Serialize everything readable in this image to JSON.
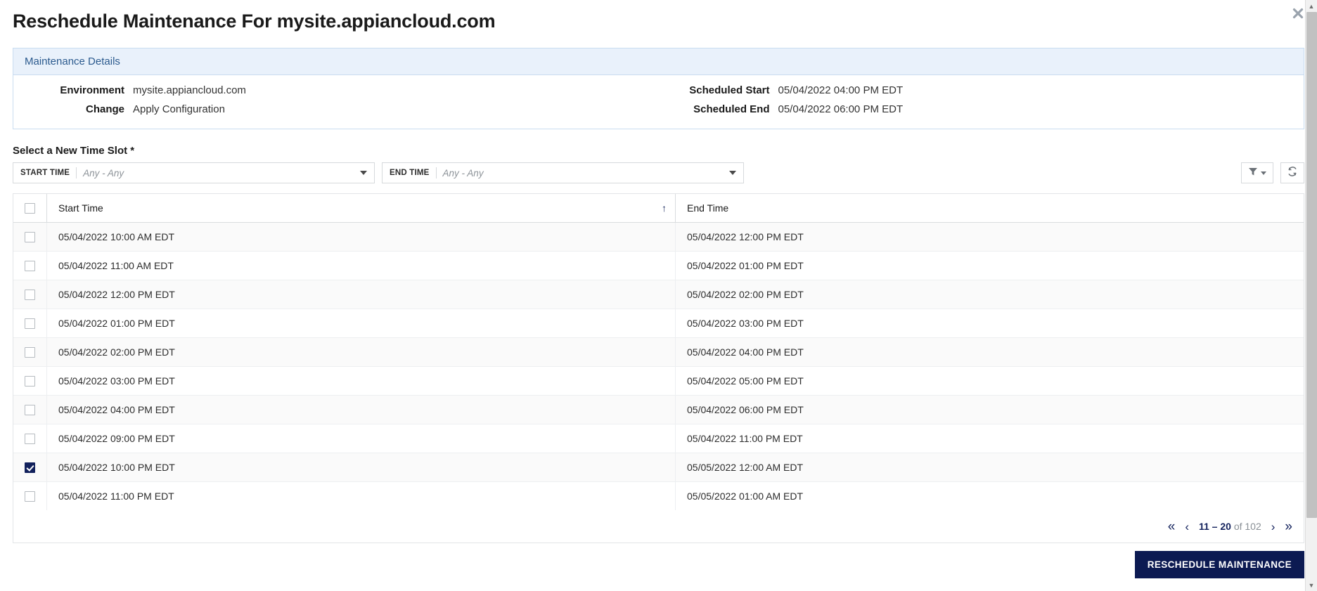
{
  "dialog": {
    "title": "Reschedule Maintenance For mysite.appiancloud.com",
    "close_icon": "close-icon"
  },
  "details": {
    "header": "Maintenance Details",
    "left_fields": [
      {
        "label": "Environment",
        "value": "mysite.appiancloud.com"
      },
      {
        "label": "Change",
        "value": "Apply Configuration"
      }
    ],
    "right_fields": [
      {
        "label": "Scheduled Start",
        "value": "05/04/2022 04:00 PM EDT"
      },
      {
        "label": "Scheduled End",
        "value": "05/04/2022 06:00 PM EDT"
      }
    ]
  },
  "time_slot": {
    "section_label": "Select a New Time Slot *",
    "filters": {
      "start": {
        "label": "START TIME",
        "placeholder": "Any - Any",
        "value": ""
      },
      "end": {
        "label": "END TIME",
        "placeholder": "Any - Any",
        "value": ""
      }
    },
    "toolbar": {
      "filter_icon": "funnel-icon",
      "refresh_icon": "refresh-icon"
    }
  },
  "table": {
    "columns": [
      "Start Time",
      "End Time"
    ],
    "sort": {
      "column": "Start Time",
      "direction": "ascending",
      "glyph": "↑"
    },
    "select_all_checked": false,
    "rows": [
      {
        "selected": false,
        "start": "05/04/2022 10:00 AM EDT",
        "end": "05/04/2022 12:00 PM EDT"
      },
      {
        "selected": false,
        "start": "05/04/2022 11:00 AM EDT",
        "end": "05/04/2022 01:00 PM EDT"
      },
      {
        "selected": false,
        "start": "05/04/2022 12:00 PM EDT",
        "end": "05/04/2022 02:00 PM EDT"
      },
      {
        "selected": false,
        "start": "05/04/2022 01:00 PM EDT",
        "end": "05/04/2022 03:00 PM EDT"
      },
      {
        "selected": false,
        "start": "05/04/2022 02:00 PM EDT",
        "end": "05/04/2022 04:00 PM EDT"
      },
      {
        "selected": false,
        "start": "05/04/2022 03:00 PM EDT",
        "end": "05/04/2022 05:00 PM EDT"
      },
      {
        "selected": false,
        "start": "05/04/2022 04:00 PM EDT",
        "end": "05/04/2022 06:00 PM EDT"
      },
      {
        "selected": false,
        "start": "05/04/2022 09:00 PM EDT",
        "end": "05/04/2022 11:00 PM EDT"
      },
      {
        "selected": true,
        "start": "05/04/2022 10:00 PM EDT",
        "end": "05/05/2022 12:00 AM EDT"
      },
      {
        "selected": false,
        "start": "05/04/2022 11:00 PM EDT",
        "end": "05/05/2022 01:00 AM EDT"
      }
    ]
  },
  "pagination": {
    "first_glyph": "«",
    "prev_glyph": "‹",
    "next_glyph": "›",
    "last_glyph": "»",
    "range": "11 – 20",
    "suffix": "of 102"
  },
  "footer": {
    "primary_button": "RESCHEDULE MAINTENANCE"
  },
  "colors": {
    "primary": "#0c1a52",
    "panel_header_bg": "#e9f1fb",
    "panel_border": "#c9dcf0",
    "accent_text": "#2b5a8e"
  }
}
